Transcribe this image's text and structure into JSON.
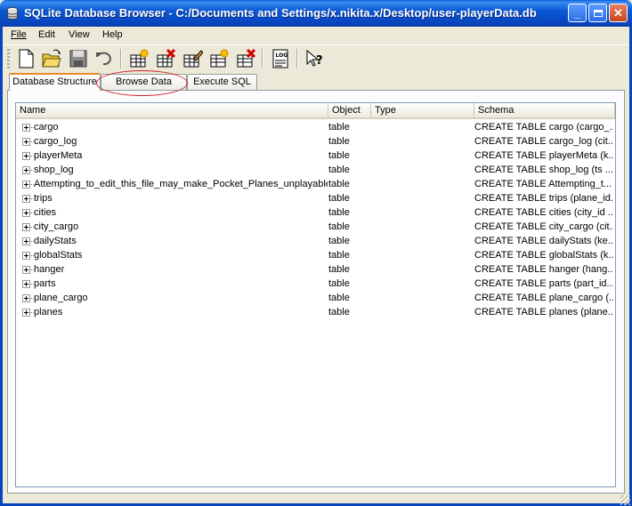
{
  "window": {
    "title": "SQLite Database Browser - C:/Documents and Settings/x.nikita.x/Desktop/user-playerData.db",
    "controls": {
      "minimize": "_",
      "maximize": "□",
      "close": "✕"
    }
  },
  "menu": {
    "file": "File",
    "edit": "Edit",
    "view": "View",
    "help": "Help"
  },
  "toolbar": {
    "icons": [
      "new-database-icon",
      "open-database-icon",
      "save-database-icon",
      "undo-icon",
      "create-table-icon",
      "delete-table-icon",
      "modify-table-icon",
      "create-index-icon",
      "delete-index-icon",
      "sql-log-icon",
      "whats-this-icon"
    ]
  },
  "tabs": {
    "structure": "Database Structure",
    "browse": "Browse Data",
    "sql": "Execute SQL",
    "active": "structure",
    "highlight_color": "#d6242a"
  },
  "table": {
    "columns": [
      "Name",
      "Object",
      "Type",
      "Schema"
    ],
    "rows": [
      {
        "name": "cargo",
        "object": "table",
        "type": "",
        "schema": "CREATE TABLE cargo (cargo_..."
      },
      {
        "name": "cargo_log",
        "object": "table",
        "type": "",
        "schema": "CREATE TABLE cargo_log (cit..."
      },
      {
        "name": "playerMeta",
        "object": "table",
        "type": "",
        "schema": "CREATE TABLE playerMeta (k..."
      },
      {
        "name": "shop_log",
        "object": "table",
        "type": "",
        "schema": "CREATE TABLE shop_log (ts ..."
      },
      {
        "name": "Attempting_to_edit_this_file_may_make_Pocket_Planes_unplayable",
        "object": "table",
        "type": "",
        "schema": "CREATE TABLE Attempting_t..."
      },
      {
        "name": "trips",
        "object": "table",
        "type": "",
        "schema": "CREATE TABLE trips (plane_id..."
      },
      {
        "name": "cities",
        "object": "table",
        "type": "",
        "schema": "CREATE TABLE cities (city_id ..."
      },
      {
        "name": "city_cargo",
        "object": "table",
        "type": "",
        "schema": "CREATE TABLE city_cargo (cit..."
      },
      {
        "name": "dailyStats",
        "object": "table",
        "type": "",
        "schema": "CREATE TABLE dailyStats (ke..."
      },
      {
        "name": "globalStats",
        "object": "table",
        "type": "",
        "schema": "CREATE TABLE globalStats (k..."
      },
      {
        "name": "hanger",
        "object": "table",
        "type": "",
        "schema": "CREATE TABLE hanger (hang..."
      },
      {
        "name": "parts",
        "object": "table",
        "type": "",
        "schema": "CREATE TABLE parts (part_id..."
      },
      {
        "name": "plane_cargo",
        "object": "table",
        "type": "",
        "schema": "CREATE TABLE plane_cargo (..."
      },
      {
        "name": "planes",
        "object": "table",
        "type": "",
        "schema": "CREATE TABLE planes (plane..."
      }
    ]
  }
}
